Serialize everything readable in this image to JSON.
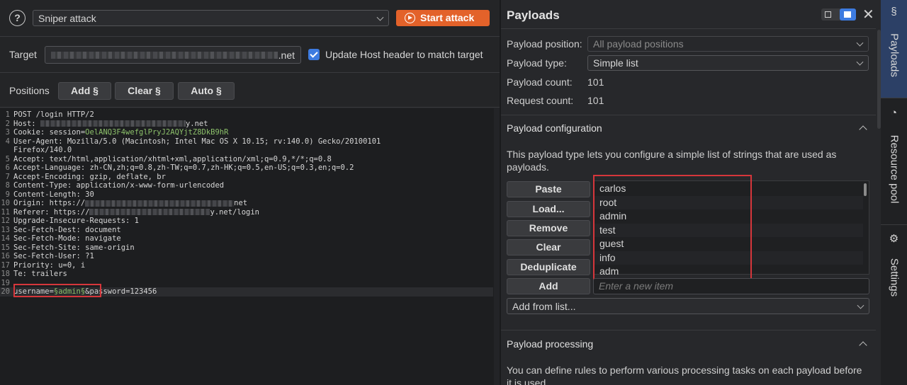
{
  "toolbar": {
    "help_glyph": "?",
    "attack_type": "Sniper attack",
    "start_label": "Start attack"
  },
  "target": {
    "label": "Target",
    "value_suffix": ".net",
    "update_host_label": "Update Host header to match target",
    "update_host_checked": true
  },
  "positions": {
    "label": "Positions",
    "add_label": "Add §",
    "clear_label": "Clear §",
    "auto_label": "Auto §"
  },
  "request": {
    "lines": [
      {
        "n": "1",
        "text": "POST /login HTTP/2"
      },
      {
        "n": "2",
        "text": "Host: ",
        "tail": "y.net"
      },
      {
        "n": "3",
        "text": "Cookie: session=",
        "green": "OelANQ3F4wefglPryJ2AQYjtZ8DkB9hR"
      },
      {
        "n": "4",
        "text": "User-Agent: Mozilla/5.0 (Macintosh; Intel Mac OS X 10.15; rv:140.0) Gecko/20100101"
      },
      {
        "n": "",
        "text": "Firefox/140.0"
      },
      {
        "n": "5",
        "text": "Accept: text/html,application/xhtml+xml,application/xml;q=0.9,*/*;q=0.8"
      },
      {
        "n": "6",
        "text": "Accept-Language: zh-CN,zh;q=0.8,zh-TW;q=0.7,zh-HK;q=0.5,en-US;q=0.3,en;q=0.2"
      },
      {
        "n": "7",
        "text": "Accept-Encoding: gzip, deflate, br"
      },
      {
        "n": "8",
        "text": "Content-Type: application/x-www-form-urlencoded"
      },
      {
        "n": "9",
        "text": "Content-Length: 30"
      },
      {
        "n": "10",
        "text": "Origin: https://",
        "tail": "net"
      },
      {
        "n": "11",
        "text": "Referer: https://",
        "tail": "y.net/login"
      },
      {
        "n": "12",
        "text": "Upgrade-Insecure-Requests: 1"
      },
      {
        "n": "13",
        "text": "Sec-Fetch-Dest: document"
      },
      {
        "n": "14",
        "text": "Sec-Fetch-Mode: navigate"
      },
      {
        "n": "15",
        "text": "Sec-Fetch-Site: same-origin"
      },
      {
        "n": "16",
        "text": "Sec-Fetch-User: ?1"
      },
      {
        "n": "17",
        "text": "Priority: u=0, i"
      },
      {
        "n": "18",
        "text": "Te: trailers"
      },
      {
        "n": "19",
        "text": ""
      },
      {
        "n": "20",
        "text": "username=",
        "green": "§admin§",
        "rest": "&password=123456"
      }
    ]
  },
  "payloads": {
    "title": "Payloads",
    "position_label": "Payload position:",
    "position_value": "All payload positions",
    "type_label": "Payload type:",
    "type_value": "Simple list",
    "count_label": "Payload count:",
    "count_value": "101",
    "request_label": "Request count:",
    "request_value": "101",
    "config_title": "Payload configuration",
    "config_desc": "This payload type lets you configure a simple list of strings that are used as payloads.",
    "buttons": [
      "Paste",
      "Load...",
      "Remove",
      "Clear",
      "Deduplicate"
    ],
    "add_label": "Add",
    "items": [
      "carlos",
      "root",
      "admin",
      "test",
      "guest",
      "info",
      "adm"
    ],
    "new_item_placeholder": "Enter a new item",
    "add_from_list": "Add from list...",
    "processing_title": "Payload processing",
    "processing_desc": "You can define rules to perform various processing tasks on each payload before it is used."
  },
  "tabs": {
    "payloads": "Payloads",
    "resource_pool": "Resource pool",
    "settings": "Settings",
    "payloads_icon": "§",
    "resource_icon": "◔",
    "settings_icon": "⚙"
  },
  "colors": {
    "accent": "#e3622a",
    "highlight": "#d6363b",
    "selected_tab": "#2c4066",
    "green_text": "#8cc06a"
  }
}
